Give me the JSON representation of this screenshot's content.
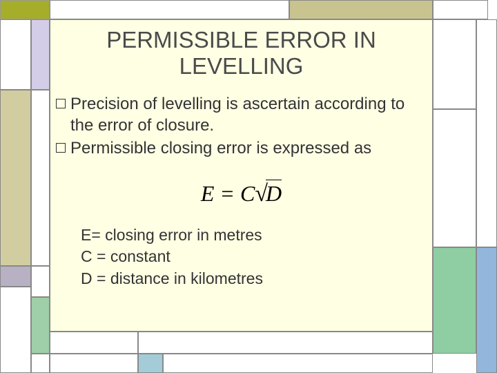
{
  "title": "PERMISSIBLE ERROR IN LEVELLING",
  "bullets": [
    "Precision of levelling is ascertain according to the error of closure.",
    "Permissible closing error is expressed as"
  ],
  "formula": {
    "lhs": "E",
    "eq": " = ",
    "coeff": "C",
    "radicand": "D"
  },
  "legend": [
    "E= closing error in metres",
    "C = constant",
    "D = distance in kilometres"
  ]
}
